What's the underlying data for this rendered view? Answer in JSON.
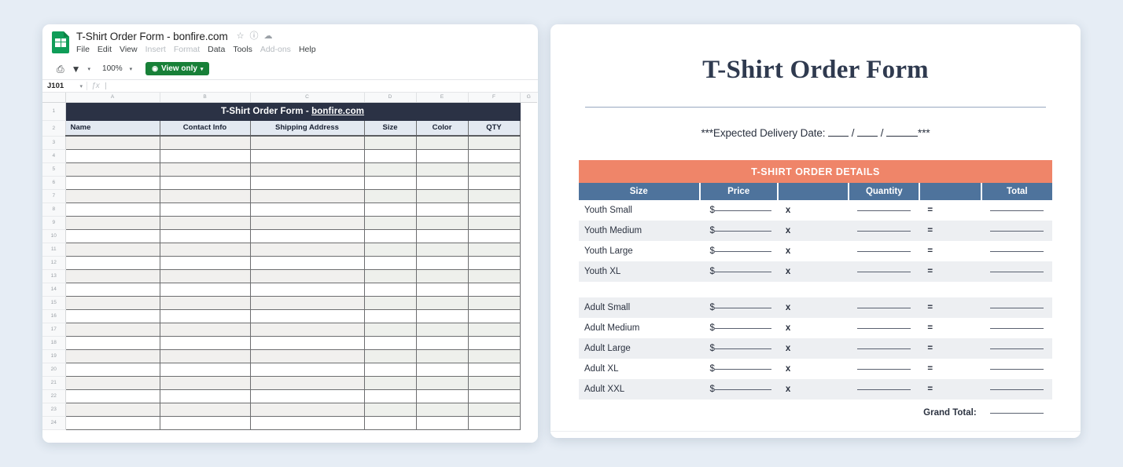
{
  "sheets": {
    "doc_title": "T-Shirt Order Form - bonfire.com",
    "title_icons": [
      {
        "name": "star-icon",
        "glyph": "☆"
      },
      {
        "name": "move-to-folder-icon",
        "glyph": "ⓘ"
      },
      {
        "name": "cloud-status-icon",
        "glyph": "☁"
      }
    ],
    "menus": [
      {
        "label": "File",
        "dim": false
      },
      {
        "label": "Edit",
        "dim": false
      },
      {
        "label": "View",
        "dim": false
      },
      {
        "label": "Insert",
        "dim": true
      },
      {
        "label": "Format",
        "dim": true
      },
      {
        "label": "Data",
        "dim": false
      },
      {
        "label": "Tools",
        "dim": false
      },
      {
        "label": "Add-ons",
        "dim": true
      },
      {
        "label": "Help",
        "dim": false
      }
    ],
    "toolbar": {
      "print_icon": "⎙",
      "filter_icon": "▼",
      "filter_caret": "▾",
      "zoom_level": "100%",
      "zoom_caret": "▾",
      "view_only_label": "View only",
      "view_only_eye": "◉",
      "view_only_caret": "▾"
    },
    "formula_bar": {
      "name_box": "J101",
      "name_caret": "▾",
      "fx_label": "ƒx",
      "formula_value": ""
    },
    "columns": [
      "A",
      "B",
      "C",
      "D",
      "E",
      "F",
      "G"
    ],
    "row_numbers": [
      "1",
      "2",
      "3",
      "4",
      "5",
      "6",
      "7",
      "8",
      "9",
      "10",
      "11",
      "12",
      "13",
      "14",
      "15",
      "16",
      "17",
      "18",
      "19",
      "20",
      "21",
      "22",
      "23",
      "24"
    ],
    "banner": {
      "prefix": "T-Shirt Order Form - ",
      "link": "bonfire.com"
    },
    "headers": [
      "Name",
      "Contact Info",
      "Shipping Address",
      "Size",
      "Color",
      "QTY"
    ]
  },
  "form": {
    "title": "T-Shirt Order Form",
    "delivery_prefix": "***Expected Delivery Date: ",
    "delivery_suffix": "***",
    "delivery_sep": "/",
    "section_title": "T-SHIRT ORDER DETAILS",
    "columns": [
      "Size",
      "Price",
      "",
      "Quantity",
      "",
      "Total"
    ],
    "currency": "$",
    "multiply_symbol": "x",
    "equals_symbol": "=",
    "rows": [
      {
        "size": "Youth Small",
        "zebra": false
      },
      {
        "size": "Youth Medium",
        "zebra": true
      },
      {
        "size": "Youth Large",
        "zebra": false
      },
      {
        "size": "Youth XL",
        "zebra": true
      },
      {
        "size": "Adult Small",
        "zebra": true
      },
      {
        "size": "Adult Medium",
        "zebra": false
      },
      {
        "size": "Adult Large",
        "zebra": true
      },
      {
        "size": "Adult XL",
        "zebra": false
      },
      {
        "size": "Adult XXL",
        "zebra": true
      }
    ],
    "grand_total_label": "Grand Total:"
  },
  "colors": {
    "page_background": "#e6edf5",
    "banner_navy": "#2b3245",
    "header_blue": "#4e739c",
    "accent_orange": "#ef8569",
    "sheets_green": "#0f9d58",
    "view_only_green": "#188038",
    "zebra_gray": "#edeff2"
  }
}
